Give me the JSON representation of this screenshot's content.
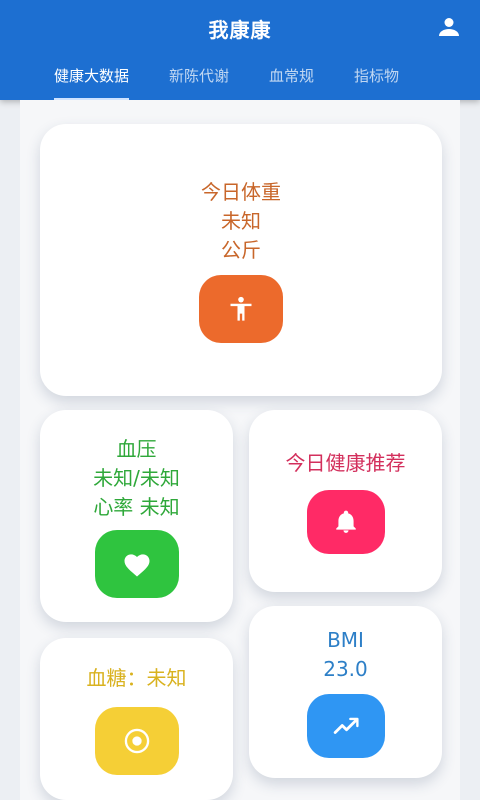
{
  "app": {
    "title": "我康康"
  },
  "tabs": [
    {
      "label": "健康大数据",
      "active": true
    },
    {
      "label": "新陈代谢",
      "active": false
    },
    {
      "label": "血常规",
      "active": false
    },
    {
      "label": "指标物",
      "active": false
    }
  ],
  "cards": {
    "weight": {
      "title": "今日体重",
      "value": "未知",
      "unit": "公斤",
      "color": "#c8662a",
      "button_color": "#ec6a2c",
      "icon": "accessibility-icon"
    },
    "blood_pressure": {
      "title": "血压",
      "value": "未知/未知",
      "heart_rate": "心率 未知",
      "color": "#2fa83a",
      "button_color": "#2fc43f",
      "icon": "heart-icon"
    },
    "recommend": {
      "title": "今日健康推荐",
      "color": "#d32f5c",
      "button_color": "#ff2a66",
      "icon": "bell-icon"
    },
    "blood_sugar": {
      "title": "血糖：未知",
      "color": "#d9b21f",
      "button_color": "#f5cf36",
      "icon": "target-icon"
    },
    "bmi": {
      "title": "BMI",
      "value": "23.0",
      "color": "#2d7fc7",
      "button_color": "#2f96f3",
      "icon": "trending-icon"
    }
  },
  "colors": {
    "appbar": "#1d6fd1"
  }
}
